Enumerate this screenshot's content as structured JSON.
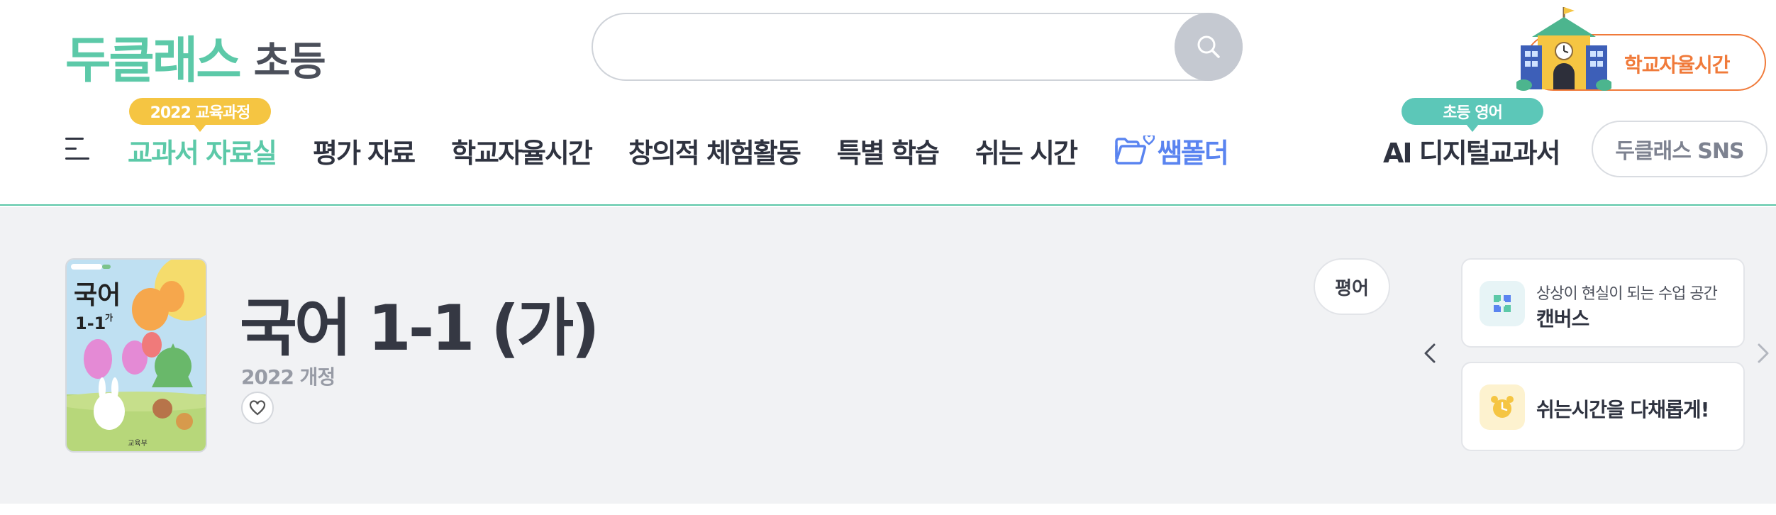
{
  "header": {
    "logo_main": "두클래스",
    "logo_sub": "초등",
    "search_placeholder": "",
    "school_button_label": "학교자율시간",
    "nav": {
      "badge_curriculum": "2022 교육과정",
      "items": [
        "교과서 자료실",
        "평가 자료",
        "학교자율시간",
        "창의적 체험활동",
        "특별 학습",
        "쉬는 시간",
        "쌤폴더"
      ],
      "badge_english": "초등 영어",
      "ai_textbook": "AI 디지털교과서",
      "sns_button": "두클래스 SNS"
    }
  },
  "book": {
    "title": "국어 1-1 (가)",
    "edition": "2022 개정",
    "cover": {
      "subject": "국어",
      "grade": "1-1",
      "grade_suffix": "가",
      "publisher": "교육부"
    }
  },
  "review_button": "평어",
  "side_cards": [
    {
      "sub": "상상이 현실이 되는 수업 공간",
      "main": "캔버스"
    },
    {
      "sub": "",
      "main": "쉬는시간을 다채롭게!"
    }
  ],
  "colors": {
    "brand_green": "#5cc9a8",
    "orange": "#f07a3a",
    "blue_folder": "#5a84f0",
    "badge_yellow": "#f5c542",
    "badge_teal": "#5cc7b8"
  }
}
